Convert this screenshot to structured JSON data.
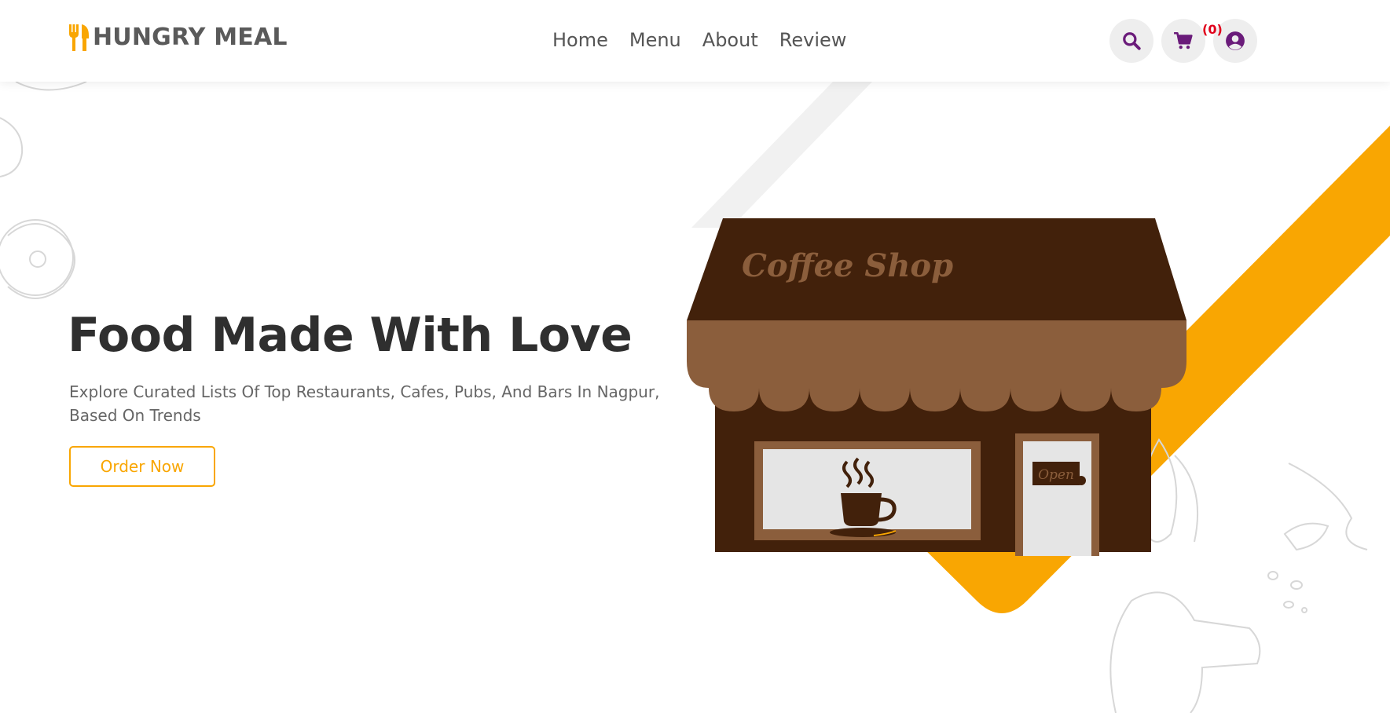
{
  "brand": {
    "name": "HUNGRY MEAL",
    "icon": "utensils-icon",
    "accent_color": "#f9a602"
  },
  "nav": {
    "items": [
      {
        "label": "Home"
      },
      {
        "label": "Menu"
      },
      {
        "label": "About"
      },
      {
        "label": "Review"
      }
    ]
  },
  "header_icons": {
    "search_icon": "search-icon",
    "cart_icon": "cart-icon",
    "user_icon": "user-circle-icon",
    "cart_count": "(0)",
    "icon_color": "#6a1b7a",
    "badge_color": "#e0001b"
  },
  "hero": {
    "title": "Food Made With Love",
    "subtitle": "Explore Curated Lists Of Top Restaurants, Cafes, Pubs, And Bars In Nagpur, Based On Trends",
    "cta_label": "Order Now"
  },
  "illustration": {
    "awning_text": "Coffee Shop",
    "door_sign": "Open",
    "shop_dark": "#42210b",
    "shop_light": "#8b5e3c"
  }
}
